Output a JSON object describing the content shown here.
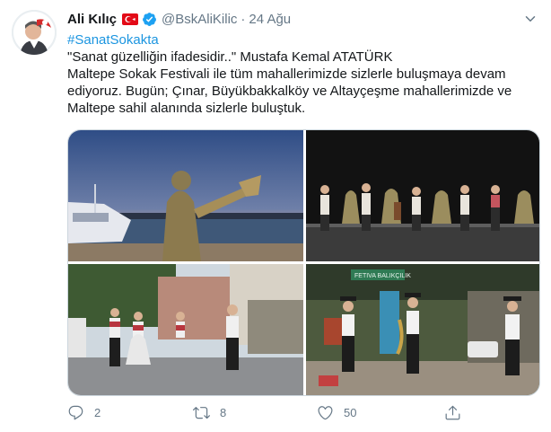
{
  "author": {
    "name": "Ali Kılıç",
    "handle": "@BskAliKilic",
    "separator": "·",
    "time": "24 Ağu"
  },
  "tweet": {
    "hashtag": "#SanatSokakta",
    "lines": [
      "\"Sanat güzelliğin ifadesidir..\" Mustafa Kemal ATATÜRK",
      "Maltepe Sokak Festivali ile tüm mahallerimizde sizlerle buluşmaya devam",
      "ediyoruz. Bugün; Çınar, Büyükbakkalköy ve Altayçeşme mahallerimizde ve",
      "Maltepe sahil alanında sizlerle buluştuk."
    ]
  },
  "media": {
    "photo4_sign": "FETIVA BALIKÇILIK"
  },
  "actions": {
    "reply_count": "2",
    "retweet_count": "8",
    "like_count": "50"
  },
  "icons": [
    "flag-icon",
    "verified-icon",
    "caret-down-icon",
    "reply-icon",
    "retweet-icon",
    "like-icon",
    "share-icon"
  ],
  "colors": {
    "link": "#1b95e0",
    "muted": "#657786",
    "verified": "#1da1f2"
  }
}
